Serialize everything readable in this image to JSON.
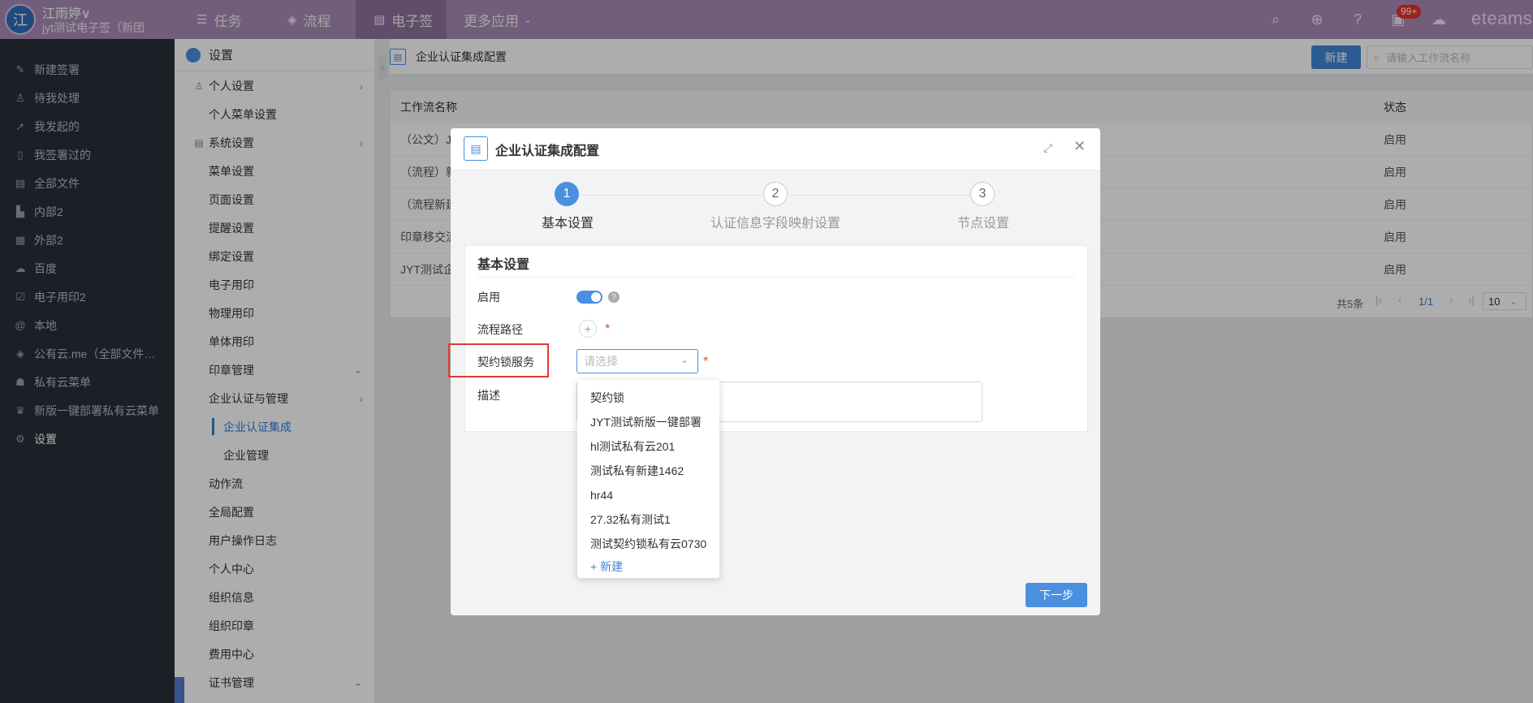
{
  "topbar": {
    "avatar_letter": "江",
    "user_name": "江雨婷∨",
    "user_org": "jyt测试电子签（新团",
    "nav": [
      {
        "label": "任务",
        "icon": "task-icon"
      },
      {
        "label": "流程",
        "icon": "workflow-icon"
      },
      {
        "label": "电子签",
        "icon": "esign-icon"
      },
      {
        "label": "更多应用",
        "icon": "chevron-down-icon"
      }
    ],
    "badge": "99+",
    "brand": "eteams"
  },
  "sidebar": {
    "items": [
      {
        "label": "新建签署",
        "icon": "pen-icon"
      },
      {
        "label": "待我处理",
        "icon": "user-check-icon"
      },
      {
        "label": "我发起的",
        "icon": "send-icon"
      },
      {
        "label": "我签署过的",
        "icon": "signed-doc-icon"
      },
      {
        "label": "全部文件",
        "icon": "files-icon"
      },
      {
        "label": "内部2",
        "icon": "bar-chart-icon"
      },
      {
        "label": "外部2",
        "icon": "grid-icon"
      },
      {
        "label": "百度",
        "icon": "cloud-icon"
      },
      {
        "label": "电子用印2",
        "icon": "checkbox-icon"
      },
      {
        "label": "本地",
        "icon": "at-icon"
      },
      {
        "label": "公有云.me（全部文件…",
        "icon": "layers-icon"
      },
      {
        "label": "私有云菜单",
        "icon": "users-icon"
      },
      {
        "label": "新版一键部署私有云菜单",
        "icon": "crown-icon"
      },
      {
        "label": "设置",
        "icon": "gear-icon"
      }
    ]
  },
  "settings_panel": {
    "title": "设置",
    "items": [
      {
        "label": "个人设置"
      },
      {
        "label": "个人菜单设置"
      },
      {
        "label": "系统设置"
      },
      {
        "label": "菜单设置"
      },
      {
        "label": "页面设置"
      },
      {
        "label": "提醒设置"
      },
      {
        "label": "绑定设置"
      },
      {
        "label": "电子用印"
      },
      {
        "label": "物理用印"
      },
      {
        "label": "单体用印"
      },
      {
        "label": "印章管理"
      },
      {
        "label": "企业认证与管理"
      },
      {
        "label": "企业认证集成"
      },
      {
        "label": "企业管理"
      },
      {
        "label": "动作流"
      },
      {
        "label": "全局配置"
      },
      {
        "label": "用户操作日志"
      },
      {
        "label": "个人中心"
      },
      {
        "label": "组织信息"
      },
      {
        "label": "组织印章"
      },
      {
        "label": "费用中心"
      },
      {
        "label": "证书管理"
      }
    ]
  },
  "main": {
    "title": "企业认证集成配置",
    "new_button": "新建",
    "search_placeholder": "请输入工作流名称",
    "columns": [
      "工作流名称",
      "状态"
    ],
    "rows": [
      {
        "name": "（公文）J",
        "status": "启用"
      },
      {
        "name": "（流程）新",
        "status": "启用"
      },
      {
        "name": "（流程新建",
        "status": "启用"
      },
      {
        "name": "印章移交流",
        "status": "启用"
      },
      {
        "name": "JYT测试企",
        "status": "启用"
      }
    ],
    "pager": {
      "total": "共5条",
      "page": "1/1",
      "size": "10"
    }
  },
  "dialog": {
    "title": "企业认证集成配置",
    "steps": [
      {
        "num": "1",
        "label": "基本设置"
      },
      {
        "num": "2",
        "label": "认证信息字段映射设置"
      },
      {
        "num": "3",
        "label": "节点设置"
      }
    ],
    "section_title": "基本设置",
    "fields": {
      "enable_label": "启用",
      "path_label": "流程路径",
      "service_label": "契约锁服务",
      "service_placeholder": "请选择",
      "desc_label": "描述"
    },
    "dropdown_options": [
      "契约锁",
      "JYT测试新版一键部署",
      "hl测试私有云201",
      "测试私有新建1462",
      "hr44",
      "27.32私有测试1",
      "测试契约锁私有云0730"
    ],
    "dropdown_new": "+ 新建",
    "next_button": "下一步"
  },
  "colors": {
    "accent": "#4a8fe0",
    "topbar": "#a98bb5",
    "sidebar": "#2b2f3a",
    "highlight": "#e53935"
  }
}
